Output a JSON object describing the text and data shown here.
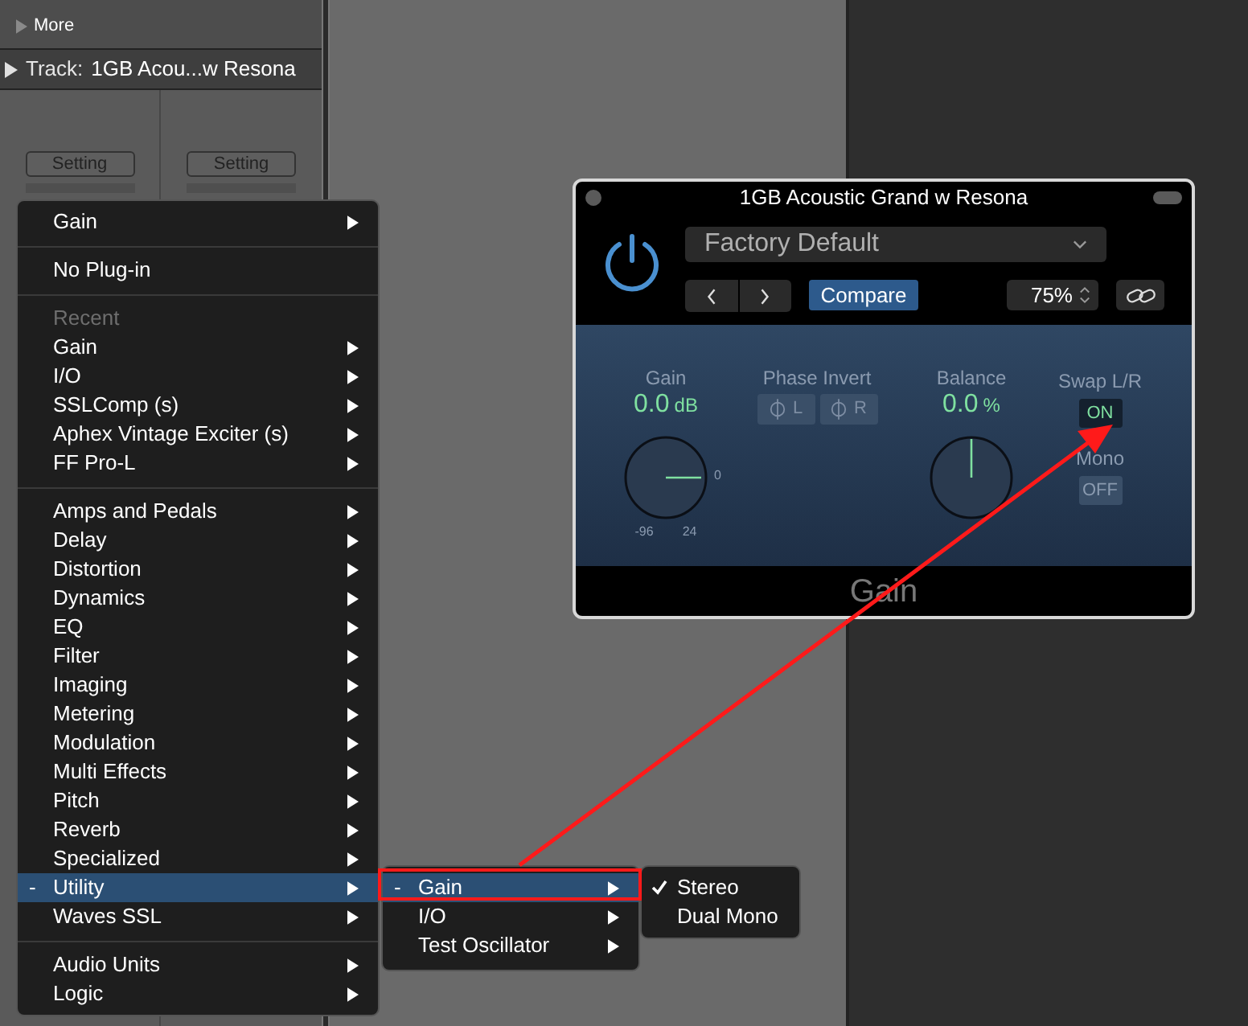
{
  "inspector": {
    "more": "More",
    "track_label": "Track:",
    "track_name": "1GB Acou...w Resona",
    "settings": [
      "Setting",
      "Setting"
    ]
  },
  "plugin_menu": {
    "items": [
      {
        "kind": "item",
        "label": "Gain",
        "submenu": true,
        "selected": false
      },
      {
        "kind": "separator"
      },
      {
        "kind": "item",
        "label": "No Plug-in",
        "submenu": false,
        "selected": false
      },
      {
        "kind": "separator"
      },
      {
        "kind": "header",
        "label": "Recent"
      },
      {
        "kind": "item",
        "label": "Gain",
        "submenu": true,
        "selected": false
      },
      {
        "kind": "item",
        "label": "I/O",
        "submenu": true,
        "selected": false
      },
      {
        "kind": "item",
        "label": "SSLComp (s)",
        "submenu": true,
        "selected": false
      },
      {
        "kind": "item",
        "label": "Aphex Vintage Exciter (s)",
        "submenu": true,
        "selected": false
      },
      {
        "kind": "item",
        "label": "FF Pro-L",
        "submenu": true,
        "selected": false
      },
      {
        "kind": "separator"
      },
      {
        "kind": "item",
        "label": "Amps and Pedals",
        "submenu": true,
        "selected": false
      },
      {
        "kind": "item",
        "label": "Delay",
        "submenu": true,
        "selected": false
      },
      {
        "kind": "item",
        "label": "Distortion",
        "submenu": true,
        "selected": false
      },
      {
        "kind": "item",
        "label": "Dynamics",
        "submenu": true,
        "selected": false
      },
      {
        "kind": "item",
        "label": "EQ",
        "submenu": true,
        "selected": false
      },
      {
        "kind": "item",
        "label": "Filter",
        "submenu": true,
        "selected": false
      },
      {
        "kind": "item",
        "label": "Imaging",
        "submenu": true,
        "selected": false
      },
      {
        "kind": "item",
        "label": "Metering",
        "submenu": true,
        "selected": false
      },
      {
        "kind": "item",
        "label": "Modulation",
        "submenu": true,
        "selected": false
      },
      {
        "kind": "item",
        "label": "Multi Effects",
        "submenu": true,
        "selected": false
      },
      {
        "kind": "item",
        "label": "Pitch",
        "submenu": true,
        "selected": false
      },
      {
        "kind": "item",
        "label": "Reverb",
        "submenu": true,
        "selected": false
      },
      {
        "kind": "item",
        "label": "Specialized",
        "submenu": true,
        "selected": false
      },
      {
        "kind": "item",
        "label": "Utility",
        "marker": "-",
        "submenu": true,
        "selected": true
      },
      {
        "kind": "item",
        "label": "Waves SSL",
        "submenu": true,
        "selected": false
      },
      {
        "kind": "separator"
      },
      {
        "kind": "item",
        "label": "Audio Units",
        "submenu": true,
        "selected": false
      },
      {
        "kind": "item",
        "label": "Logic",
        "submenu": true,
        "selected": false
      }
    ]
  },
  "utility_submenu": {
    "items": [
      {
        "label": "Gain",
        "marker": "-",
        "submenu": true,
        "selected": true
      },
      {
        "label": "I/O",
        "submenu": true,
        "selected": false
      },
      {
        "label": "Test Oscillator",
        "submenu": true,
        "selected": false
      }
    ]
  },
  "gain_submenu": {
    "items": [
      {
        "label": "Stereo",
        "checked": true
      },
      {
        "label": "Dual Mono",
        "checked": false
      }
    ]
  },
  "plugin_window": {
    "title": "1GB Acoustic Grand w Resona",
    "power_on": true,
    "preset": "Factory Default",
    "compare": "Compare",
    "zoom": "75%",
    "gain": {
      "label": "Gain",
      "value": "0.0",
      "unit": "dB",
      "scale_max": "0",
      "scale_low": "-96",
      "scale_high": "24"
    },
    "phase_invert": {
      "label": "Phase Invert",
      "buttons": [
        {
          "label": "L",
          "on": false
        },
        {
          "label": "R",
          "on": false
        }
      ]
    },
    "balance": {
      "label": "Balance",
      "value": "0.0",
      "unit": "%"
    },
    "swap": {
      "label": "Swap L/R",
      "value": "ON",
      "on": true
    },
    "mono": {
      "label": "Mono",
      "value": "OFF",
      "on": false
    },
    "footer": "Gain"
  }
}
